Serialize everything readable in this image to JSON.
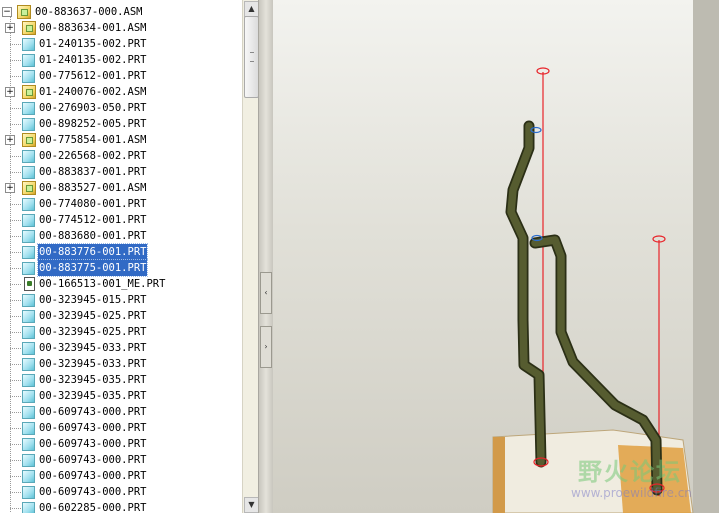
{
  "tree": {
    "root_label": "00-883637-000.ASM",
    "items": [
      {
        "label": "00-883634-001.ASM",
        "type": "asm",
        "expandable": true,
        "selected": false
      },
      {
        "label": "01-240135-002.PRT",
        "type": "prt",
        "expandable": false,
        "selected": false
      },
      {
        "label": "01-240135-002.PRT",
        "type": "prt",
        "expandable": false,
        "selected": false
      },
      {
        "label": "00-775612-001.PRT",
        "type": "prt",
        "expandable": false,
        "selected": false
      },
      {
        "label": "01-240076-002.ASM",
        "type": "asm",
        "expandable": true,
        "selected": false
      },
      {
        "label": "00-276903-050.PRT",
        "type": "prt",
        "expandable": false,
        "selected": false
      },
      {
        "label": "00-898252-005.PRT",
        "type": "prt",
        "expandable": false,
        "selected": false
      },
      {
        "label": "00-775854-001.ASM",
        "type": "asm",
        "expandable": true,
        "selected": false
      },
      {
        "label": "00-226568-002.PRT",
        "type": "prt",
        "expandable": false,
        "selected": false
      },
      {
        "label": "00-883837-001.PRT",
        "type": "prt",
        "expandable": false,
        "selected": false
      },
      {
        "label": "00-883527-001.ASM",
        "type": "asm",
        "expandable": true,
        "selected": false
      },
      {
        "label": "00-774080-001.PRT",
        "type": "prt",
        "expandable": false,
        "selected": false
      },
      {
        "label": "00-774512-001.PRT",
        "type": "prt",
        "expandable": false,
        "selected": false
      },
      {
        "label": "00-883680-001.PRT",
        "type": "prt",
        "expandable": false,
        "selected": false
      },
      {
        "label": "00-883776-001.PRT",
        "type": "prt",
        "expandable": false,
        "selected": true
      },
      {
        "label": "00-883775-001.PRT",
        "type": "prt",
        "expandable": false,
        "selected": true
      },
      {
        "label": "00-166513-001_ME.PRT",
        "type": "doc",
        "expandable": false,
        "selected": false
      },
      {
        "label": "00-323945-015.PRT",
        "type": "prt",
        "expandable": false,
        "selected": false
      },
      {
        "label": "00-323945-025.PRT",
        "type": "prt",
        "expandable": false,
        "selected": false
      },
      {
        "label": "00-323945-025.PRT",
        "type": "prt",
        "expandable": false,
        "selected": false
      },
      {
        "label": "00-323945-033.PRT",
        "type": "prt",
        "expandable": false,
        "selected": false
      },
      {
        "label": "00-323945-033.PRT",
        "type": "prt",
        "expandable": false,
        "selected": false
      },
      {
        "label": "00-323945-035.PRT",
        "type": "prt",
        "expandable": false,
        "selected": false
      },
      {
        "label": "00-323945-035.PRT",
        "type": "prt",
        "expandable": false,
        "selected": false
      },
      {
        "label": "00-609743-000.PRT",
        "type": "prt",
        "expandable": false,
        "selected": false
      },
      {
        "label": "00-609743-000.PRT",
        "type": "prt",
        "expandable": false,
        "selected": false
      },
      {
        "label": "00-609743-000.PRT",
        "type": "prt",
        "expandable": false,
        "selected": false
      },
      {
        "label": "00-609743-000.PRT",
        "type": "prt",
        "expandable": false,
        "selected": false
      },
      {
        "label": "00-609743-000.PRT",
        "type": "prt",
        "expandable": false,
        "selected": false
      },
      {
        "label": "00-609743-000.PRT",
        "type": "prt",
        "expandable": false,
        "selected": false
      },
      {
        "label": "00-602285-000.PRT",
        "type": "prt",
        "expandable": false,
        "selected": false
      }
    ]
  },
  "icons": {
    "expand": "plus-icon",
    "asm": "assembly-icon",
    "prt": "part-icon",
    "doc": "document-icon",
    "scroll_up": "arrow-up-icon",
    "scroll_down": "arrow-down-icon",
    "collapse_left": "chevron-left-icon",
    "expand_right": "chevron-right-icon"
  },
  "colors": {
    "selection": "#316ac5",
    "pipe": "#4a4f2a",
    "axis_line": "#e8242a",
    "viewport_bg": "#e1e0d8"
  },
  "watermark": {
    "text": "野火论坛",
    "url": "www.proewildfire.cn"
  }
}
